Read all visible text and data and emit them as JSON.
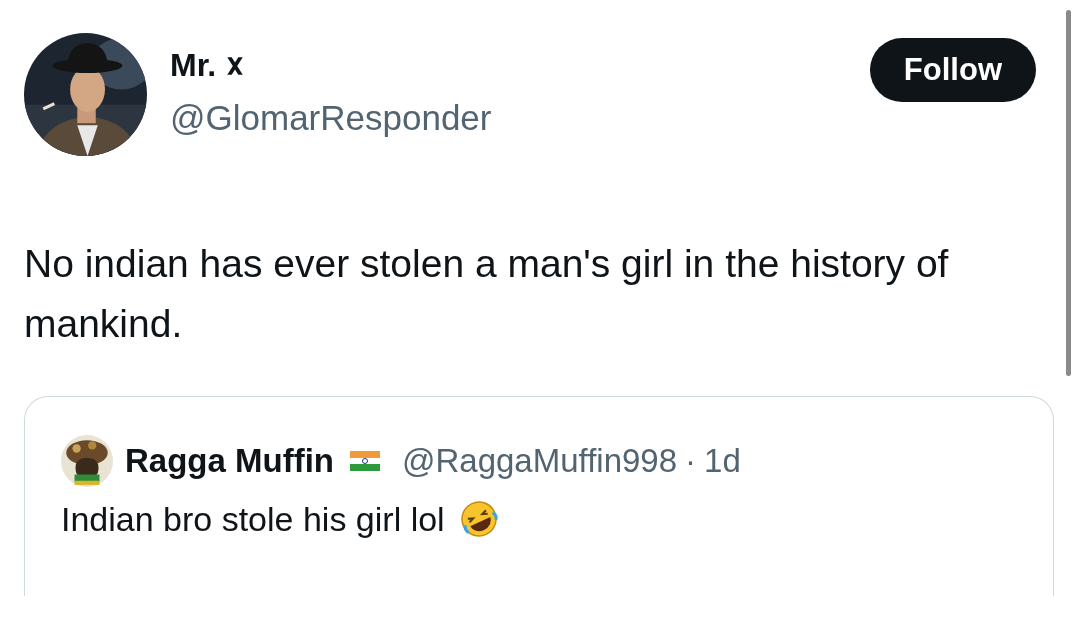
{
  "author": {
    "name": "Mr.",
    "handle": "@GlomarResponder"
  },
  "follow_button": {
    "label": "Follow"
  },
  "text": "No indian has ever stolen a man's girl in the history of mankind.",
  "quoted_post": {
    "name": "Ragga Muffin",
    "handle": "@RaggaMuffin998",
    "separator": "·",
    "time": "1d",
    "text": "Indian bro stole his girl lol"
  }
}
